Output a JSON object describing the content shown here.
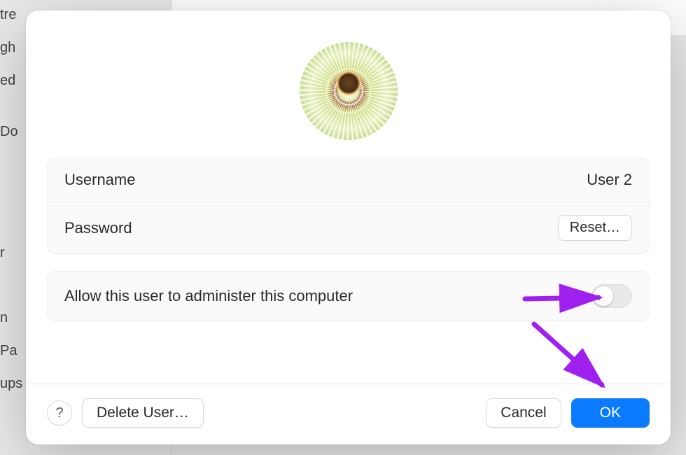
{
  "background": {
    "items": [
      "tre",
      "gh",
      "ed",
      "Do",
      "r",
      "n",
      "Pa",
      "ups"
    ]
  },
  "dialog": {
    "username": {
      "label": "Username",
      "value": "User 2"
    },
    "password": {
      "label": "Password",
      "reset_label": "Reset…"
    },
    "admin": {
      "label": "Allow this user to administer this computer",
      "enabled": false
    },
    "footer": {
      "help_label": "?",
      "delete_label": "Delete User…",
      "cancel_label": "Cancel",
      "ok_label": "OK"
    }
  },
  "annotation_color": "#a020f0"
}
